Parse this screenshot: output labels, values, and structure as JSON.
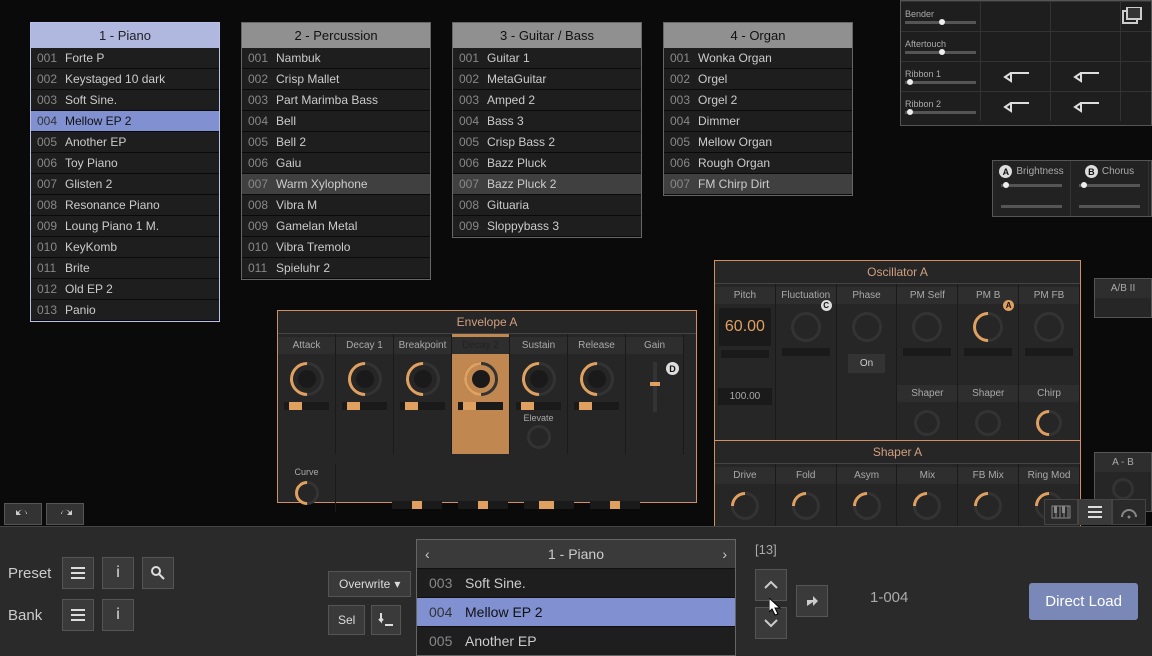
{
  "categories": [
    {
      "title": "1 - Piano",
      "items": [
        {
          "n": "001",
          "name": "Forte P"
        },
        {
          "n": "002",
          "name": "Keystaged 10 dark"
        },
        {
          "n": "003",
          "name": "Soft Sine."
        },
        {
          "n": "004",
          "name": "Mellow EP 2",
          "selblue": true
        },
        {
          "n": "005",
          "name": "Another EP"
        },
        {
          "n": "006",
          "name": "Toy Piano"
        },
        {
          "n": "007",
          "name": "Glisten 2"
        },
        {
          "n": "008",
          "name": "Resonance Piano"
        },
        {
          "n": "009",
          "name": "Loung Piano 1 M."
        },
        {
          "n": "010",
          "name": "KeyKomb"
        },
        {
          "n": "011",
          "name": "Brite"
        },
        {
          "n": "012",
          "name": "Old EP 2"
        },
        {
          "n": "013",
          "name": "Panio"
        }
      ]
    },
    {
      "title": "2 - Percussion",
      "items": [
        {
          "n": "001",
          "name": "Nambuk"
        },
        {
          "n": "002",
          "name": "Crisp Mallet"
        },
        {
          "n": "003",
          "name": "Part Marimba Bass"
        },
        {
          "n": "004",
          "name": "Bell"
        },
        {
          "n": "005",
          "name": "Bell 2"
        },
        {
          "n": "006",
          "name": "Gaiu"
        },
        {
          "n": "007",
          "name": "Warm Xylophone",
          "sel": true
        },
        {
          "n": "008",
          "name": "Vibra M"
        },
        {
          "n": "009",
          "name": "Gamelan Metal"
        },
        {
          "n": "010",
          "name": "Vibra Tremolo"
        },
        {
          "n": "011",
          "name": "Spieluhr 2"
        }
      ]
    },
    {
      "title": "3 - Guitar / Bass",
      "items": [
        {
          "n": "001",
          "name": "Guitar 1"
        },
        {
          "n": "002",
          "name": "MetaGuitar"
        },
        {
          "n": "003",
          "name": "Amped 2"
        },
        {
          "n": "004",
          "name": "Bass 3"
        },
        {
          "n": "005",
          "name": "Crisp Bass 2"
        },
        {
          "n": "006",
          "name": "Bazz Pluck"
        },
        {
          "n": "007",
          "name": "Bazz Pluck 2",
          "sel": true
        },
        {
          "n": "008",
          "name": "Gituaria"
        },
        {
          "n": "009",
          "name": "Sloppybass 3"
        }
      ]
    },
    {
      "title": "4 - Organ",
      "items": [
        {
          "n": "001",
          "name": "Wonka Organ"
        },
        {
          "n": "002",
          "name": "Orgel"
        },
        {
          "n": "003",
          "name": "Orgel 2"
        },
        {
          "n": "004",
          "name": "Dimmer"
        },
        {
          "n": "005",
          "name": "Mellow Organ"
        },
        {
          "n": "006",
          "name": "Rough Organ"
        },
        {
          "n": "007",
          "name": "FM Chirp Dirt",
          "sel": true
        }
      ]
    }
  ],
  "mod": {
    "rows": [
      "Bender",
      "Aftertouch",
      "Ribbon 1",
      "Ribbon 2"
    ]
  },
  "macro": {
    "a": "Brightness",
    "b": "Chorus"
  },
  "envelope": {
    "title": "Envelope A",
    "stages": [
      "Attack",
      "Decay 1",
      "Breakpoint",
      "Decay 2",
      "Sustain",
      "Release",
      "Gain"
    ],
    "active": "Decay 2",
    "curve": "Curve",
    "elevate": "Elevate",
    "badge_d": "D"
  },
  "oscillator": {
    "title": "Oscillator A",
    "cols": [
      "Pitch",
      "Fluctuation",
      "Phase",
      "PM Self",
      "PM B",
      "PM FB"
    ],
    "pitch": "60.00",
    "pitch100": "100.00",
    "on": "On",
    "sub": [
      "Shaper",
      "Shaper",
      "Chirp"
    ]
  },
  "shaper": {
    "title": "Shaper A",
    "cols": [
      "Drive",
      "Fold",
      "Asym",
      "Mix",
      "FB Mix",
      "Ring Mod"
    ]
  },
  "edge": {
    "ab": "A/B II",
    "ab2": "A - B"
  },
  "bottom": {
    "preset": "Preset",
    "bank": "Bank",
    "overwrite": "Overwrite",
    "sel": "Sel",
    "browser_title": "1 - Piano",
    "browser_items": [
      {
        "n": "003",
        "name": "Soft Sine."
      },
      {
        "n": "004",
        "name": "Mellow EP 2",
        "sel": true
      },
      {
        "n": "005",
        "name": "Another EP"
      }
    ],
    "count": "[13]",
    "slot": "1-004",
    "direct_load": "Direct Load"
  }
}
